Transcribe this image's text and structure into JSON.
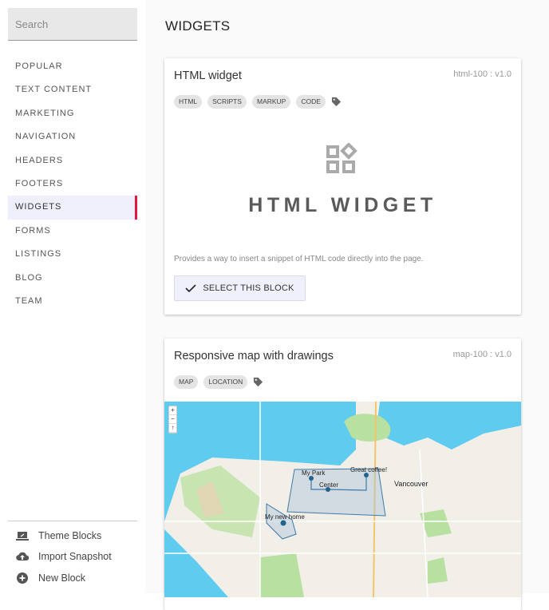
{
  "sidebar": {
    "search_placeholder": "Search",
    "items": [
      {
        "label": "POPULAR"
      },
      {
        "label": "TEXT CONTENT"
      },
      {
        "label": "MARKETING"
      },
      {
        "label": "NAVIGATION"
      },
      {
        "label": "HEADERS"
      },
      {
        "label": "FOOTERS"
      },
      {
        "label": "WIDGETS",
        "active": true
      },
      {
        "label": "FORMS"
      },
      {
        "label": "LISTINGS"
      },
      {
        "label": "BLOG"
      },
      {
        "label": "TEAM"
      }
    ],
    "bottom": [
      {
        "label": "Theme Blocks",
        "icon": "laptop-icon"
      },
      {
        "label": "Import Snapshot",
        "icon": "cloud-upload-icon"
      },
      {
        "label": "New Block",
        "icon": "add-circle-icon"
      }
    ],
    "active_color": "#e0193e"
  },
  "main": {
    "title": "WIDGETS",
    "cards": [
      {
        "title": "HTML widget",
        "id": "html-100 : v1.0",
        "tags": [
          "HTML",
          "SCRIPTS",
          "MARKUP",
          "CODE"
        ],
        "hero_text": "HTML WIDGET",
        "description": "Provides a way to insert a snippet of HTML code directly into the page.",
        "button": "SELECT THIS BLOCK"
      },
      {
        "title": "Responsive map with drawings",
        "id": "map-100 : v1.0",
        "tags": [
          "MAP",
          "LOCATION"
        ],
        "map": {
          "city_label": "Vancouver",
          "markers": [
            "My Park",
            "Great coffee!",
            "Center",
            "My new home"
          ],
          "zoom_controls": [
            "+",
            "−",
            "↑"
          ]
        }
      }
    ]
  }
}
